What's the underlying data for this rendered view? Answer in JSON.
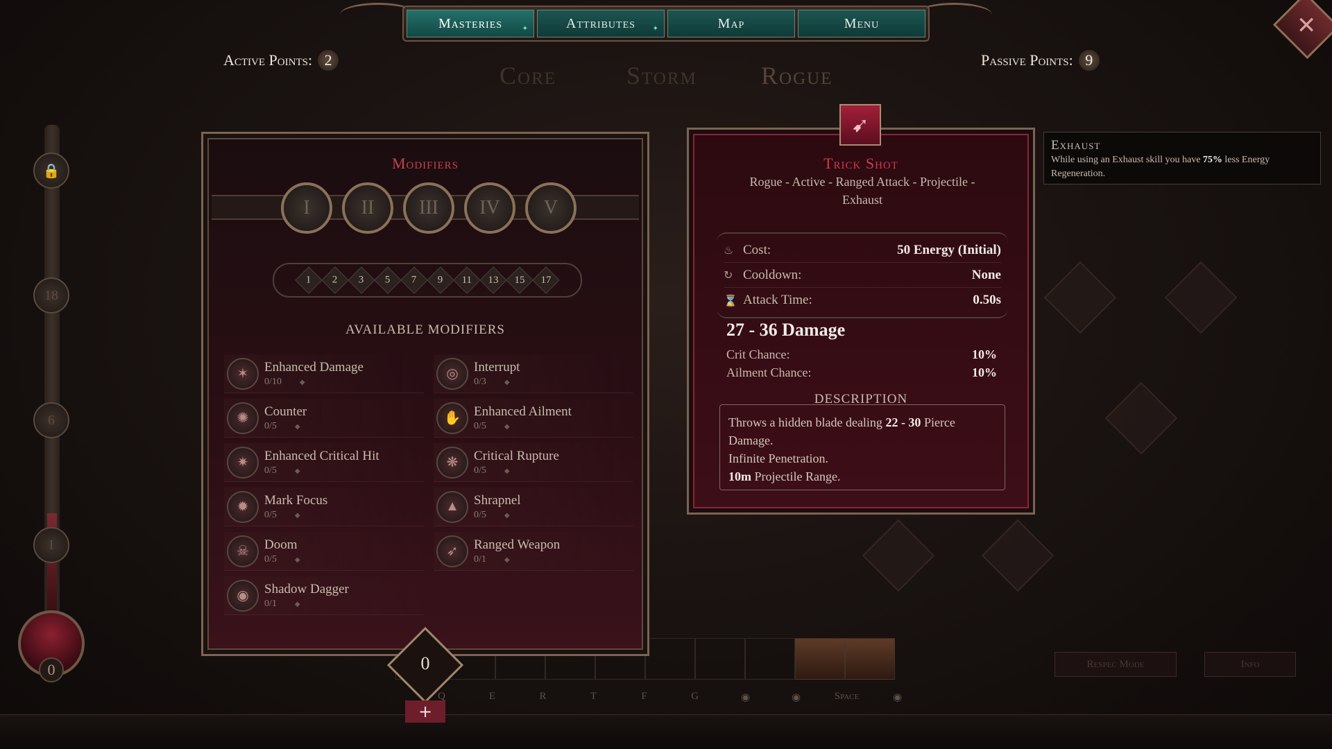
{
  "nav": {
    "tabs": [
      {
        "label": "Masteries",
        "active": true,
        "pip": "✦"
      },
      {
        "label": "Attributes",
        "active": false,
        "pip": "✦"
      },
      {
        "label": "Map",
        "active": false,
        "pip": ""
      },
      {
        "label": "Menu",
        "active": false,
        "pip": ""
      }
    ],
    "close_icon": "close-icon"
  },
  "points": {
    "active_label": "Active Points:",
    "active_value": "2",
    "passive_label": "Passive Points:",
    "passive_value": "9"
  },
  "masteries": [
    "Core",
    "Storm",
    "Rogue"
  ],
  "track": {
    "nodes": [
      "",
      "18",
      "6",
      "I"
    ],
    "orb_value": "0"
  },
  "modifiers_panel": {
    "title": "Modifiers",
    "tiers": [
      "I",
      "II",
      "III",
      "IV",
      "V"
    ],
    "levels": [
      "1",
      "2",
      "3",
      "5",
      "7",
      "9",
      "11",
      "13",
      "15",
      "17"
    ],
    "available_title": "AVAILABLE MODIFIERS",
    "items": [
      {
        "name": "Enhanced Damage",
        "count": "0/10"
      },
      {
        "name": "Interrupt",
        "count": "0/3"
      },
      {
        "name": "Counter",
        "count": "0/5"
      },
      {
        "name": "Enhanced Ailment",
        "count": "0/5"
      },
      {
        "name": "Enhanced Critical Hit",
        "count": "0/5"
      },
      {
        "name": "Critical Rupture",
        "count": "0/5"
      },
      {
        "name": "Mark Focus",
        "count": "0/5"
      },
      {
        "name": "Shrapnel",
        "count": "0/5"
      },
      {
        "name": "Doom",
        "count": "0/5"
      },
      {
        "name": "Ranged Weapon",
        "count": "0/1"
      },
      {
        "name": "Shadow Dagger",
        "count": "0/1"
      }
    ],
    "counter_value": "0",
    "add_symbol": "+"
  },
  "skill": {
    "name": "Trick Shot",
    "tags": "Rogue - Active - Ranged Attack - Projectile - Exhaust",
    "stats": [
      {
        "icon": "♨",
        "label": "Cost:",
        "value": "50 Energy (Initial)"
      },
      {
        "icon": "↻",
        "label": "Cooldown:",
        "value": "None"
      },
      {
        "icon": "⌛",
        "label": "Attack Time:",
        "value": "0.50s"
      }
    ],
    "damage": "27 - 36 Damage",
    "crit_label": "Crit Chance:",
    "crit_value": "10%",
    "ailment_label": "Ailment Chance:",
    "ailment_value": "10%",
    "description_title": "DESCRIPTION",
    "description": {
      "l1a": "Throws a hidden blade dealing ",
      "l1b": "22 - 30",
      "l1c": " Pierce Damage.",
      "l2": "Infinite Penetration.",
      "l3a": "10m",
      "l3b": " Projectile Range."
    }
  },
  "tooltip": {
    "title": "Exhaust",
    "t1": "While using an Exhaust skill you have ",
    "t2": "75%",
    "t3": " less Energy Regeneration."
  },
  "hotbar": {
    "keys": [
      "Q",
      "E",
      "R",
      "T",
      "F",
      "G",
      "",
      "",
      "Space",
      ""
    ],
    "respec_label": "Respec Mode",
    "info_label": "Info"
  },
  "colors": {
    "accent_red": "#d4394f",
    "teal_tab": "#1d5551",
    "panel_border": "#7b6450"
  }
}
